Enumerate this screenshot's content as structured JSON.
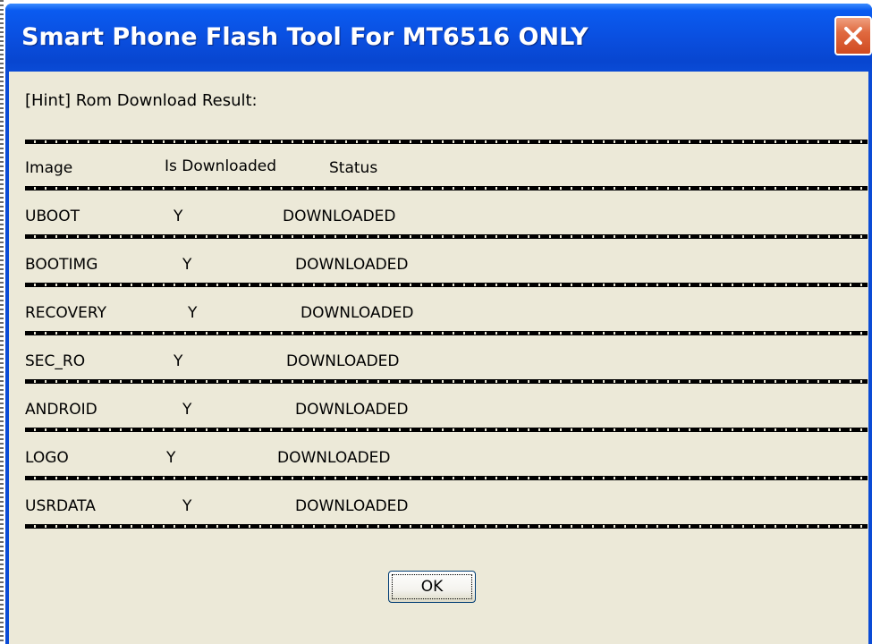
{
  "window": {
    "title": "Smart Phone Flash Tool For MT6516 ONLY"
  },
  "dialog": {
    "hint": "[Hint] Rom Download Result:",
    "separator": "==============================================================",
    "headers": {
      "image": "Image",
      "is_downloaded": "Is Downloaded",
      "status": "Status"
    },
    "rows": [
      {
        "image": "UBOOT",
        "is_downloaded": "Y",
        "status": "DOWNLOADED"
      },
      {
        "image": "BOOTIMG",
        "is_downloaded": "Y",
        "status": "DOWNLOADED"
      },
      {
        "image": "RECOVERY",
        "is_downloaded": "Y",
        "status": "DOWNLOADED"
      },
      {
        "image": "SEC_RO",
        "is_downloaded": "Y",
        "status": "DOWNLOADED"
      },
      {
        "image": "ANDROID",
        "is_downloaded": "Y",
        "status": "DOWNLOADED"
      },
      {
        "image": "LOGO",
        "is_downloaded": "Y",
        "status": "DOWNLOADED"
      },
      {
        "image": "USRDATA",
        "is_downloaded": "Y",
        "status": "DOWNLOADED"
      }
    ],
    "ok_label": "OK"
  },
  "icons": {
    "close": "close-icon"
  },
  "colors": {
    "titlebar": "#0a4fe0",
    "client_bg": "#ece9d8",
    "close_button": "#d04a20"
  }
}
